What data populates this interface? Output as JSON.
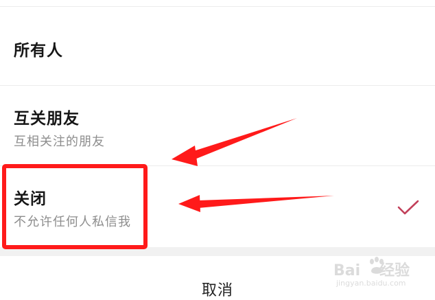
{
  "privacy_options": [
    {
      "title": "所有人",
      "subtitle": "",
      "selected": false
    },
    {
      "title": "互关朋友",
      "subtitle": "互相关注的朋友",
      "selected": false
    },
    {
      "title": "关闭",
      "subtitle": "不允许任何人私信我",
      "selected": true
    }
  ],
  "cancel_label": "取消",
  "icons": {
    "selected_check": "check-icon",
    "watermark_logo": "baidu-paw-icon"
  },
  "colors": {
    "check_color": "#c2405a",
    "annotation_color": "#ff1a1a"
  },
  "watermark": {
    "brand": "Bai",
    "brand_suffix": "经验",
    "domain": "jingyan.baidu.com"
  }
}
